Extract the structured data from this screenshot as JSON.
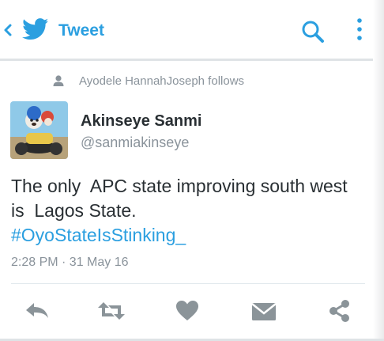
{
  "header": {
    "title": "Tweet",
    "icons": {
      "back": "chevron-left-icon",
      "logo": "twitter-bird-icon",
      "search": "search-icon",
      "more": "more-vertical-icon"
    }
  },
  "context": {
    "follow_text": "Ayodele HannahJoseph follows",
    "icon": "person-icon"
  },
  "tweet": {
    "author_name": "Akinseye Sanmi",
    "author_handle": "@sanmiakinseye",
    "text_lines": [
      "The only  APC state improving south west",
      "is  Lagos State."
    ],
    "hashtag": "#OyoStateIsStinking_",
    "timestamp": "2:28 PM · 31 May 16"
  },
  "actions": [
    {
      "name": "reply",
      "icon": "reply-icon"
    },
    {
      "name": "retweet",
      "icon": "retweet-icon"
    },
    {
      "name": "like",
      "icon": "heart-icon"
    },
    {
      "name": "message",
      "icon": "envelope-icon"
    },
    {
      "name": "share",
      "icon": "share-icon"
    }
  ],
  "colors": {
    "accent": "#2b9fe0",
    "text": "#292f33",
    "muted": "#8a939b",
    "icon_gray": "#8b9499"
  }
}
